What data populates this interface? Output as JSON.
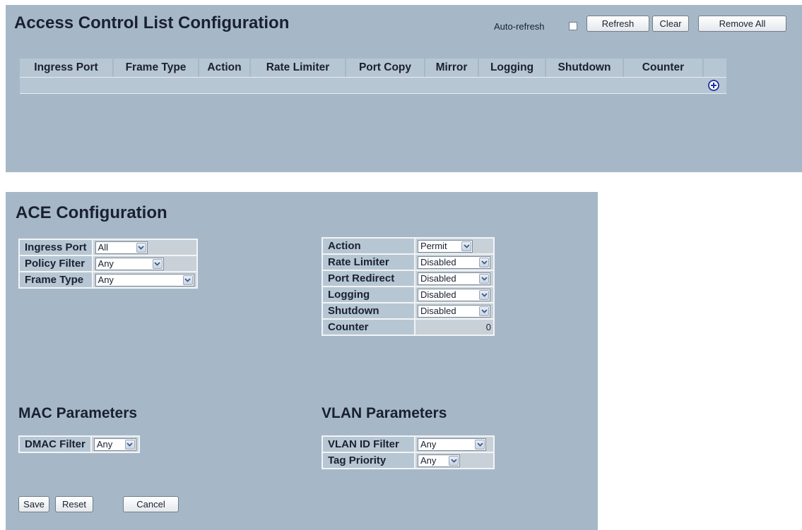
{
  "acl": {
    "title": "Access Control List Configuration",
    "auto_refresh_label": "Auto-refresh",
    "refresh_label": "Refresh",
    "clear_label": "Clear",
    "remove_all_label": "Remove All",
    "columns": [
      "Ingress Port",
      "Frame Type",
      "Action",
      "Rate Limiter",
      "Port Copy",
      "Mirror",
      "Logging",
      "Shutdown",
      "Counter"
    ],
    "add_icon": "plus-circle-icon"
  },
  "ace": {
    "title": "ACE Configuration",
    "left": [
      {
        "label": "Ingress Port",
        "value": "All"
      },
      {
        "label": "Policy Filter",
        "value": "Any"
      },
      {
        "label": "Frame Type",
        "value": "Any"
      }
    ],
    "right": [
      {
        "label": "Action",
        "value": "Permit"
      },
      {
        "label": "Rate Limiter",
        "value": "Disabled"
      },
      {
        "label": "Port Redirect",
        "value": "Disabled"
      },
      {
        "label": "Logging",
        "value": "Disabled"
      },
      {
        "label": "Shutdown",
        "value": "Disabled"
      }
    ],
    "counter": {
      "label": "Counter",
      "value": "0"
    }
  },
  "mac": {
    "title": "MAC Parameters",
    "dmac_label": "DMAC Filter",
    "dmac_value": "Any"
  },
  "vlan": {
    "title": "VLAN Parameters",
    "vid_label": "VLAN ID Filter",
    "vid_value": "Any",
    "prio_label": "Tag Priority",
    "prio_value": "Any"
  },
  "footer": {
    "save_label": "Save",
    "reset_label": "Reset",
    "cancel_label": "Cancel"
  },
  "colors": {
    "panel": "#a6b8c8",
    "header_cell": "#b7c6d3",
    "value_cell": "#c9d1d8",
    "add_icon": "#1e2f9e"
  }
}
